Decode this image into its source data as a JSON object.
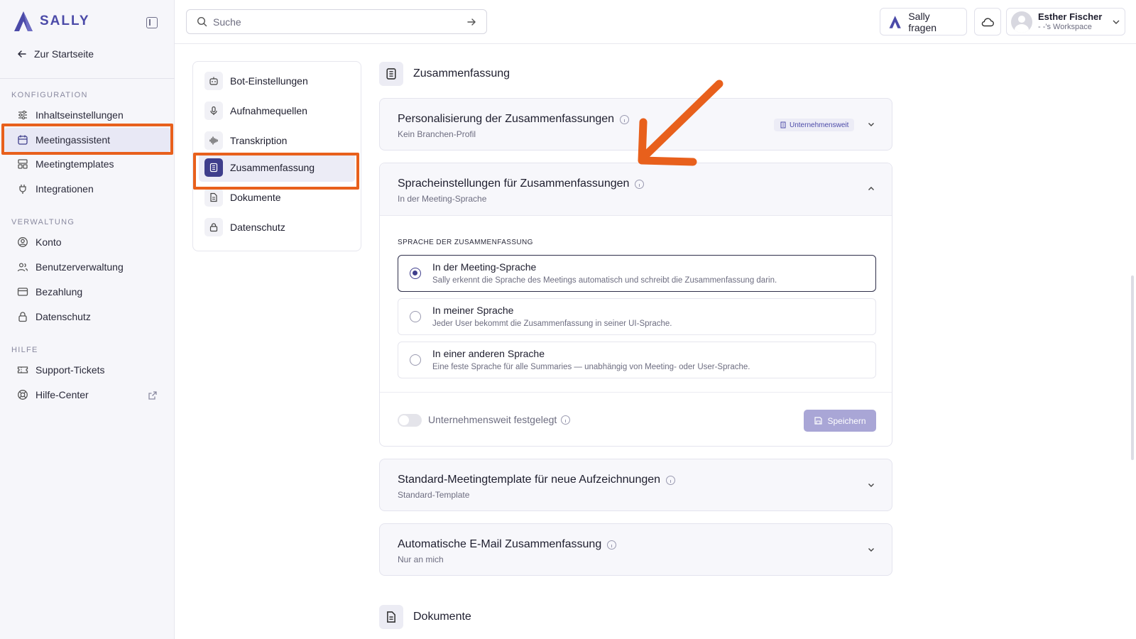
{
  "brand": {
    "name": "SALLY",
    "accent": "#4b4aa8",
    "highlight": "#e8601c"
  },
  "sidebar": {
    "back_label": "Zur Startseite",
    "sections": [
      {
        "label": "KONFIGURATION",
        "items": [
          {
            "label": "Inhaltseinstellungen",
            "icon": "sliders-icon"
          },
          {
            "label": "Meetingassistent",
            "icon": "calendar-icon",
            "active": true
          },
          {
            "label": "Meetingtemplates",
            "icon": "template-icon"
          },
          {
            "label": "Integrationen",
            "icon": "plug-icon"
          }
        ]
      },
      {
        "label": "VERWALTUNG",
        "items": [
          {
            "label": "Konto",
            "icon": "user-circle-icon"
          },
          {
            "label": "Benutzerverwaltung",
            "icon": "users-icon"
          },
          {
            "label": "Bezahlung",
            "icon": "credit-card-icon"
          },
          {
            "label": "Datenschutz",
            "icon": "lock-icon"
          }
        ]
      },
      {
        "label": "HILFE",
        "items": [
          {
            "label": "Support-Tickets",
            "icon": "ticket-icon"
          },
          {
            "label": "Hilfe-Center",
            "icon": "lifebuoy-icon"
          }
        ]
      }
    ]
  },
  "topbar": {
    "search_placeholder": "Suche",
    "ask_label": "Sally fragen",
    "user_name": "Esther Fischer",
    "workspace": "- -'s Workspace"
  },
  "subnav": {
    "items": [
      {
        "label": "Bot-Einstellungen",
        "icon": "bot-icon"
      },
      {
        "label": "Aufnahmequellen",
        "icon": "microphone-icon"
      },
      {
        "label": "Transkription",
        "icon": "waveform-icon"
      },
      {
        "label": "Zusammenfassung",
        "icon": "summary-icon",
        "active": true
      },
      {
        "label": "Dokumente",
        "icon": "document-icon"
      },
      {
        "label": "Datenschutz",
        "icon": "lock-icon"
      }
    ]
  },
  "main": {
    "section_title": "Zusammenfassung",
    "cards": [
      {
        "title": "Personalisierung der Zusammenfassungen",
        "subtitle": "Kein Branchen-Profil",
        "badge": "Unternehmensweit"
      },
      {
        "title": "Spracheinstellungen für Zusammenfassungen",
        "subtitle": "In der Meeting-Sprache",
        "lang_label": "SPRACHE DER ZUSAMMENFASSUNG",
        "options": [
          {
            "title": "In der Meeting-Sprache",
            "desc": "Sally erkennt die Sprache des Meetings automatisch und schreibt die Zusammenfassung darin.",
            "selected": true
          },
          {
            "title": "In meiner Sprache",
            "desc": "Jeder User bekommt die Zusammenfassung in seiner UI-Sprache."
          },
          {
            "title": "In einer anderen Sprache",
            "desc": "Eine feste Sprache für alle Summaries — unabhängig von Meeting- oder User-Sprache."
          }
        ],
        "toggle_label": "Unternehmensweit festgelegt",
        "save_label": "Speichern"
      },
      {
        "title": "Standard-Meetingtemplate für neue Aufzeichnungen",
        "subtitle": "Standard-Template"
      },
      {
        "title": "Automatische E-Mail Zusammenfassung",
        "subtitle": "Nur an mich"
      }
    ],
    "next_section_title": "Dokumente"
  }
}
